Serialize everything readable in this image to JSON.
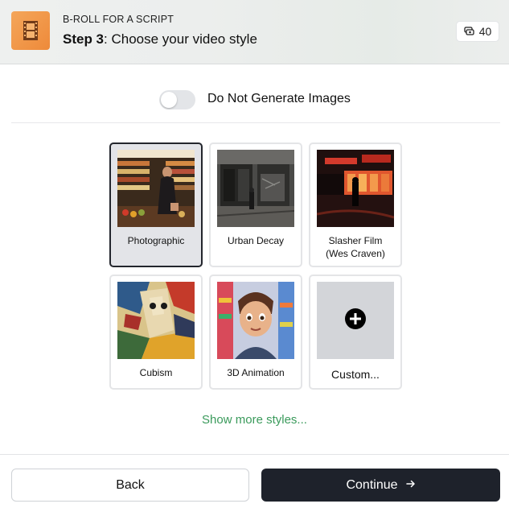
{
  "header": {
    "kicker": "B-ROLL FOR A SCRIPT",
    "step_bold": "Step 3",
    "step_text": ": Choose your video style",
    "credits": "40",
    "icon": "film-strip-icon",
    "credits_icon": "coins-icon"
  },
  "toggle": {
    "label": "Do Not Generate Images",
    "on": false
  },
  "styles": [
    {
      "label": "Photographic",
      "selected": true
    },
    {
      "label": "Urban Decay",
      "selected": false
    },
    {
      "label": "Slasher Film",
      "label2": "(Wes Craven)",
      "selected": false
    },
    {
      "label": "Cubism",
      "selected": false
    },
    {
      "label": "3D Animation",
      "selected": false
    },
    {
      "label": "Custom...",
      "selected": false,
      "icon": "plus-circle-icon"
    }
  ],
  "more_link": "Show more styles...",
  "footer": {
    "back": "Back",
    "continue": "Continue",
    "continue_icon": "arrow-right-icon"
  },
  "colors": {
    "accent_link": "#3a9a5b",
    "primary_button": "#1e222b",
    "app_icon": "#ee8a3a"
  }
}
